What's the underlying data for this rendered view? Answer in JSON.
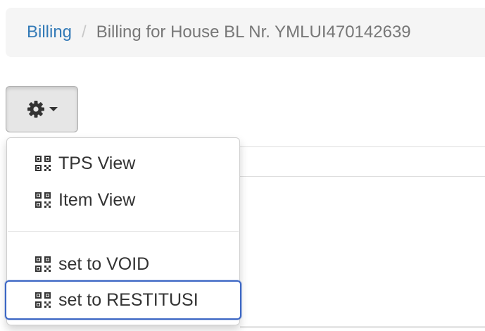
{
  "breadcrumb": {
    "parent": "Billing",
    "separator": "/",
    "current": "Billing for House BL Nr. YMLUI470142639"
  },
  "toolbar": {
    "settings_icon": "gear-icon",
    "caret_icon": "caret-down-icon"
  },
  "menu": {
    "item_icon": "qrcode-icon",
    "items": [
      {
        "label": "TPS View"
      },
      {
        "label": "Item View"
      },
      {
        "label": "set to VOID"
      },
      {
        "label": "set to RESTITUSI",
        "focused": true
      }
    ]
  },
  "colors": {
    "link": "#337ab7",
    "focus_ring": "#3b66c4"
  }
}
